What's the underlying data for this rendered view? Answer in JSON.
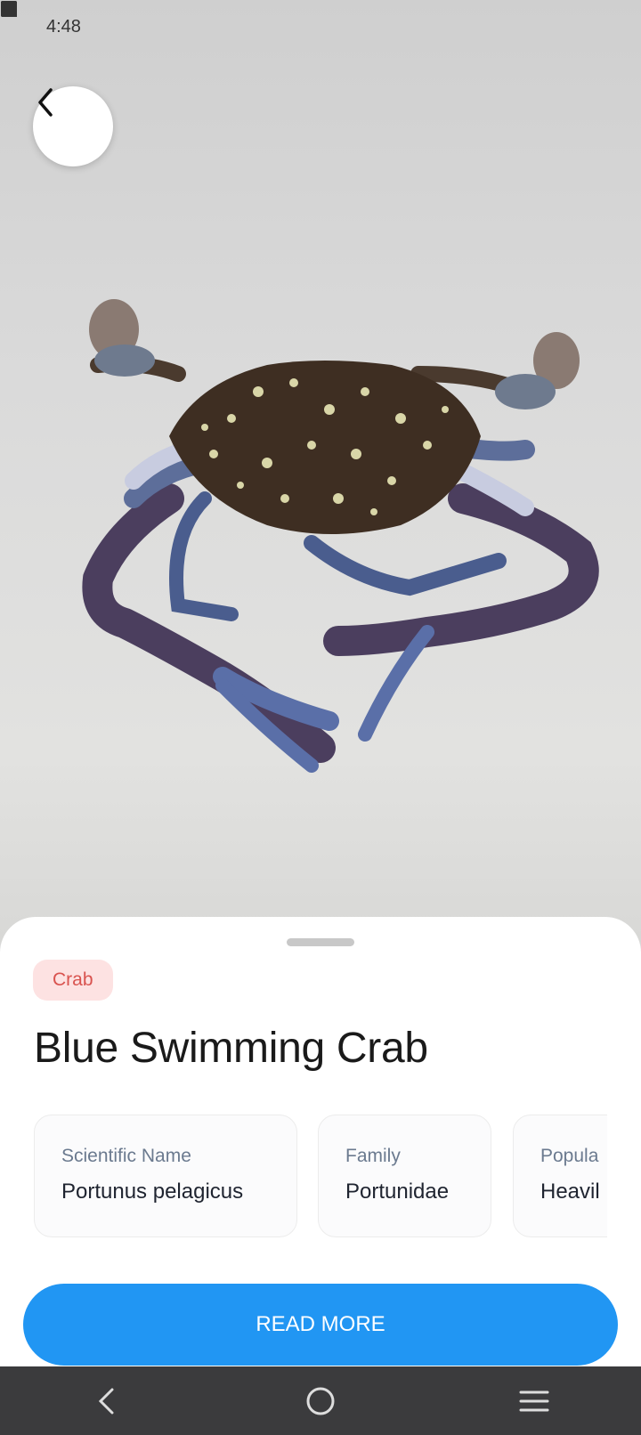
{
  "status_bar": {
    "time": "4:48",
    "left_icons": [
      "messenger-icon",
      "facebook-icon",
      "chat-bubble-icon",
      "facebook-icon",
      "dot-icon"
    ],
    "right_icons": [
      "alarm-icon",
      "wifi-icon",
      "signal-icon",
      "battery-icon"
    ]
  },
  "sheet": {
    "tag": "Crab",
    "title": "Blue Swimming Crab",
    "info_cards": [
      {
        "label": "Scientific Name",
        "value": "Portunus pelagicus"
      },
      {
        "label": "Family",
        "value": "Portunidae"
      },
      {
        "label": "Popula",
        "value": "Heavil"
      }
    ],
    "read_more_label": "READ MORE"
  },
  "colors": {
    "accent": "#2196f3",
    "tag_background": "#fde2e2",
    "tag_text": "#d9534f",
    "nav_bar": "#3b3b3d"
  }
}
